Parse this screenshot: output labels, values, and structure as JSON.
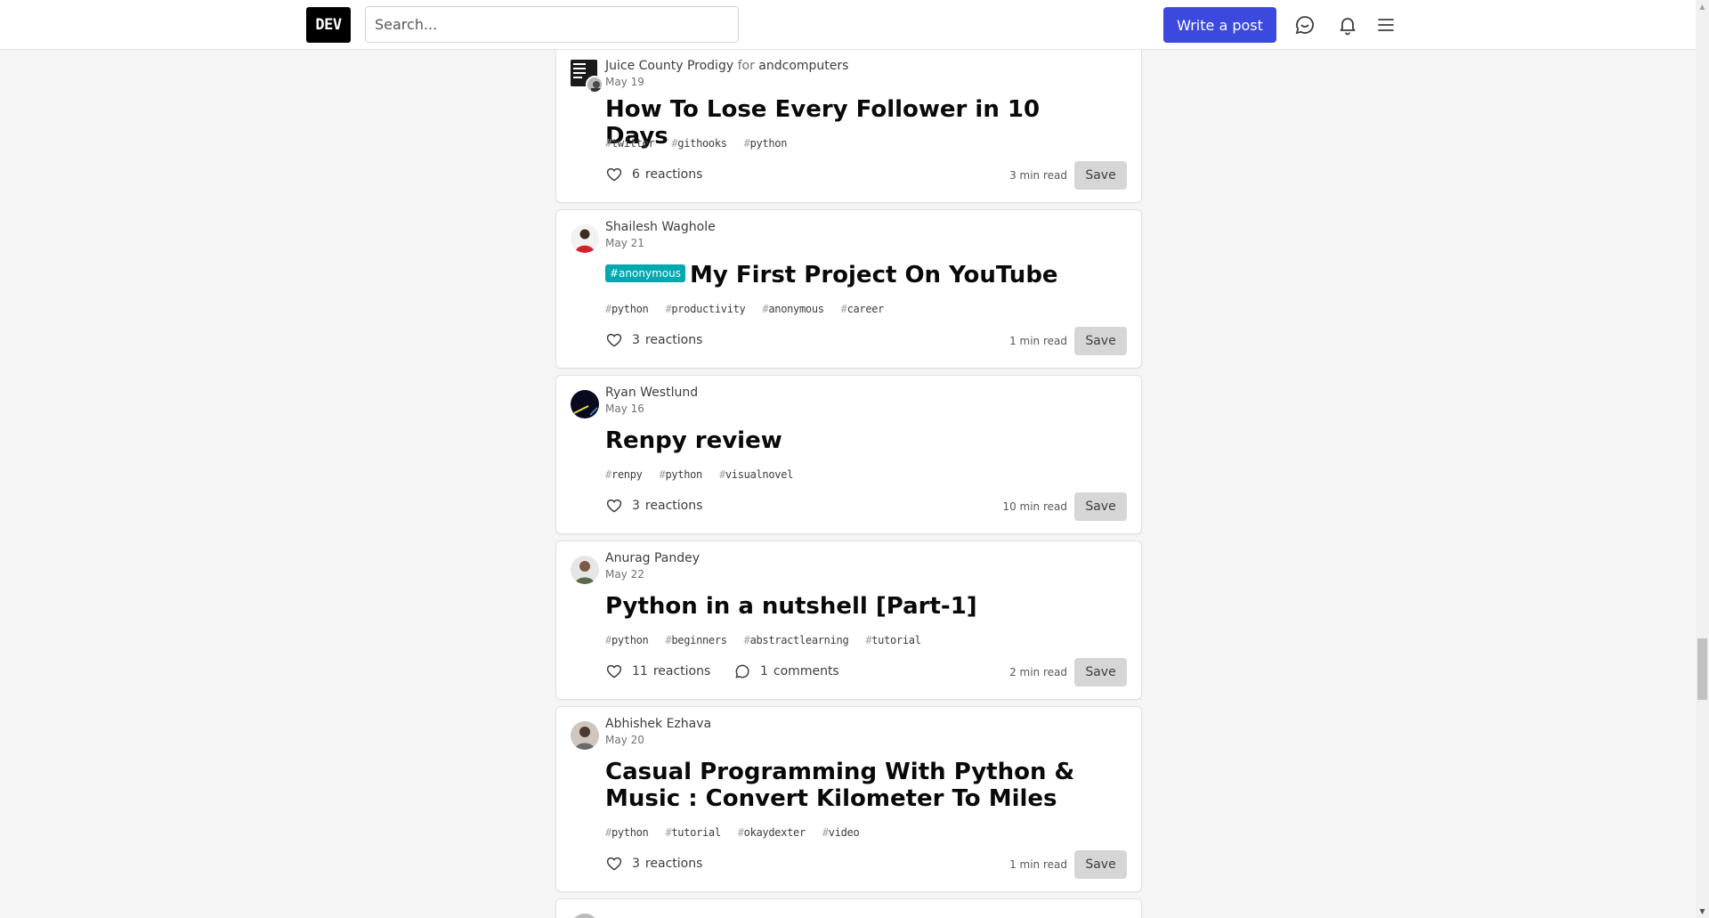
{
  "header": {
    "logo": "DEV",
    "search_placeholder": "Search...",
    "write_post": "Write a post"
  },
  "icons": {
    "logo": "dev-logo",
    "connect": "chat-bubble-icon",
    "notifications": "bell-icon",
    "menu": "hamburger-menu-icon",
    "reaction": "heart-icon",
    "comment": "comment-icon"
  },
  "colors": {
    "accent": "#3b49df",
    "flare": "#00a8b0",
    "background": "#f5f5f5"
  },
  "posts": [
    {
      "author": "Juice County Prodigy",
      "for_word": "for",
      "org": "andcomputers",
      "date": "May 19",
      "flare": "",
      "title": "How To Lose Every Follower in 10 Days",
      "tags": [
        "twitter",
        "githooks",
        "python"
      ],
      "reactions": "6",
      "reactions_label": "reactions",
      "comments": "",
      "comments_label": "",
      "read_time": "3 min read",
      "save": "Save"
    },
    {
      "author": "Shailesh Waghole",
      "date": "May 21",
      "flare": "#anonymous",
      "title": "My First Project On YouTube",
      "tags": [
        "python",
        "productivity",
        "anonymous",
        "career"
      ],
      "reactions": "3",
      "reactions_label": "reactions",
      "read_time": "1 min read",
      "save": "Save"
    },
    {
      "author": "Ryan Westlund",
      "date": "May 16",
      "flare": "",
      "title": "Renpy review",
      "tags": [
        "renpy",
        "python",
        "visualnovel"
      ],
      "reactions": "3",
      "reactions_label": "reactions",
      "read_time": "10 min read",
      "save": "Save"
    },
    {
      "author": "Anurag Pandey",
      "date": "May 22",
      "flare": "",
      "title": "Python in a nutshell [Part-1]",
      "tags": [
        "python",
        "beginners",
        "abstractlearning",
        "tutorial"
      ],
      "reactions": "11",
      "reactions_label": "reactions",
      "comments": "1",
      "comments_label": "comments",
      "read_time": "2 min read",
      "save": "Save"
    },
    {
      "author": "Abhishek Ezhava",
      "date": "May 20",
      "flare": "",
      "title": "Casual Programming With Python & Music : Convert Kilometer To Miles",
      "tags": [
        "python",
        "tutorial",
        "okaydexter",
        "video"
      ],
      "reactions": "3",
      "reactions_label": "reactions",
      "read_time": "1 min read",
      "save": "Save"
    }
  ]
}
